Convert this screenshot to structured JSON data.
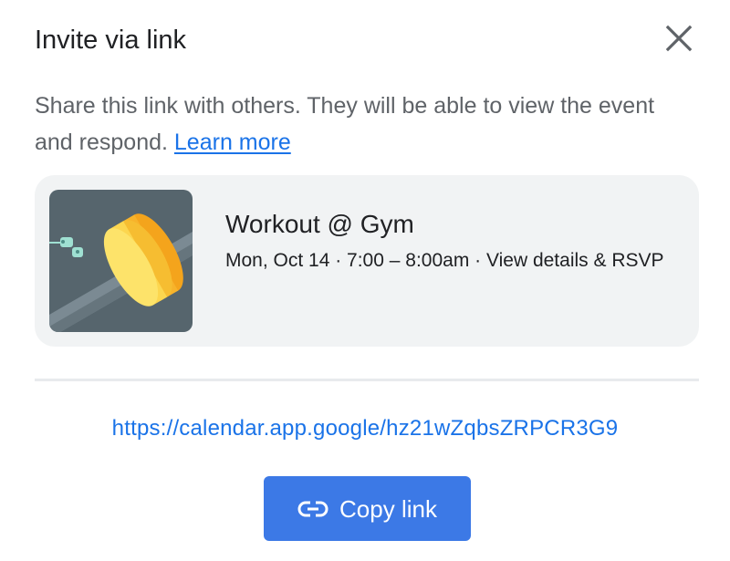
{
  "dialog": {
    "title": "Invite via link",
    "close_icon": "close-icon",
    "description": "Share this link with others. They will be able to view the event and respond.",
    "learn_more_label": "Learn more"
  },
  "event": {
    "name": "Workout @ Gym",
    "meta": "Mon, Oct 14 · 7:00 – 8:00am · View details & RSVP",
    "thumbnail_icon": "dumbbell-illustration"
  },
  "share": {
    "url": "https://calendar.app.google/hz21wZqbsZRPCR3G9",
    "copy_label": "Copy link",
    "copy_icon": "link-icon"
  },
  "colors": {
    "accent": "#1a73e8",
    "button": "#3c79e6",
    "card_bg": "#f1f3f4",
    "text_primary": "#202124",
    "text_secondary": "#5f6368"
  }
}
